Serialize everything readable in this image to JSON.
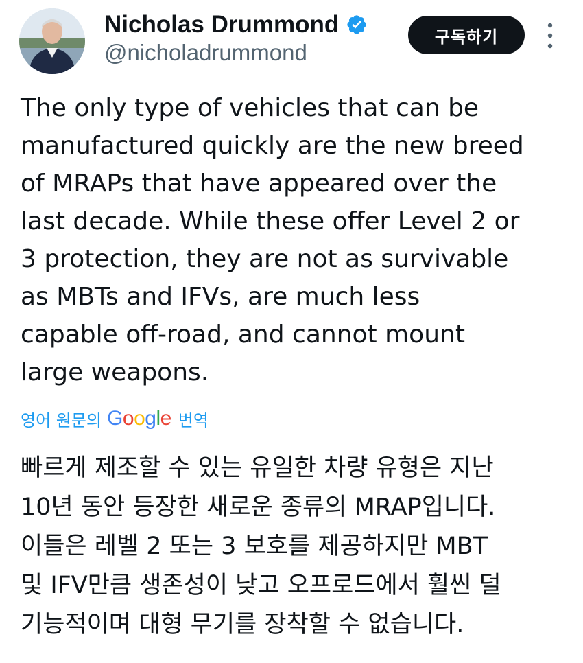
{
  "author": {
    "display_name": "Nicholas Drummond",
    "handle": "@nicholadrummond",
    "verified": true,
    "avatar_icon": "profile-photo"
  },
  "actions": {
    "subscribe_label": "구독하기",
    "more_icon": "vertical-ellipsis-icon"
  },
  "tweet": {
    "lines": [
      "The only type of vehicles that can be",
      "manufactured quickly are the new breed",
      "of MRAPs that have appeared over the",
      "last decade. While these offer Level 2 or",
      "3 protection, they are not as survivable",
      "as MBTs and IFVs, are much less",
      "capable off-road, and cannot mount",
      "large weapons."
    ]
  },
  "translation": {
    "prefix": "영어 원문의",
    "provider": "Google",
    "suffix": "번역",
    "lines": [
      "빠르게 제조할 수 있는 유일한 차량 유형은 지난",
      "10년 동안 등장한 새로운 종류의 MRAP입니다.",
      "이들은 레벨 2 또는 3 보호를 제공하지만 MBT",
      "및 IFV만큼 생존성이 낮고 오프로드에서 훨씬 덜",
      "기능적이며 대형 무기를 장착할 수 없습니다."
    ]
  },
  "colors": {
    "text": "#0f1419",
    "secondary_text": "#536471",
    "link_blue": "#1d9bf0",
    "verified_blue": "#1d9bf0",
    "button_bg": "#0f1419"
  }
}
